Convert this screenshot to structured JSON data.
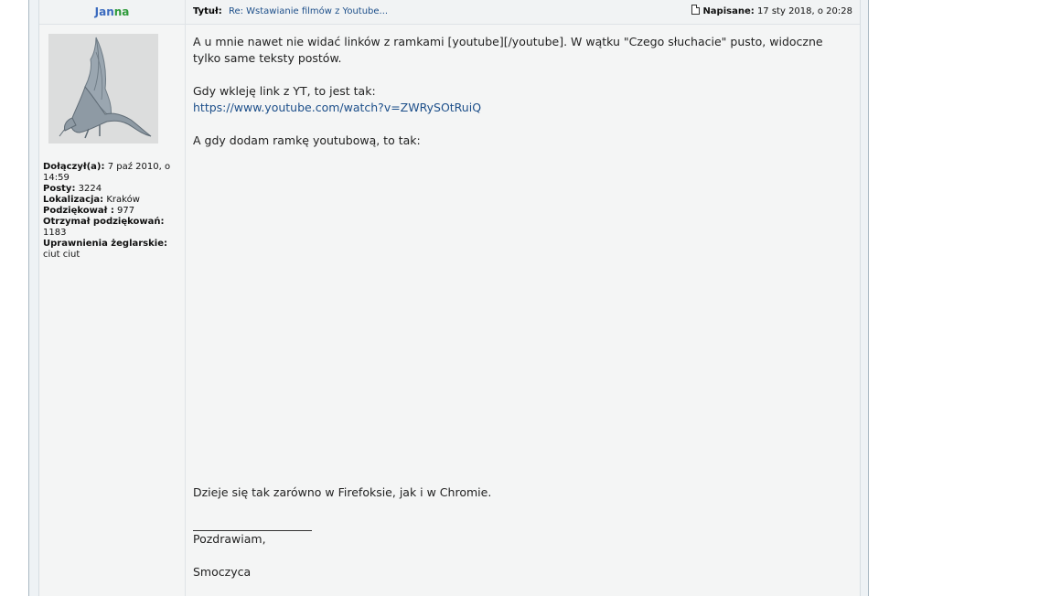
{
  "author": {
    "name_part1": "Jan",
    "name_part2": "na"
  },
  "header": {
    "title_label": "Tytuł:",
    "title_link": "Re: Wstawianie filmów z Youtube...",
    "date_label": "Napisane:",
    "date_value": "17 sty 2018, o 20:28"
  },
  "profile": {
    "joined_label": "Dołączył(a):",
    "joined_value": "7 paź 2010, o 14:59",
    "posts_label": "Posty:",
    "posts_value": "3224",
    "location_label": "Lokalizacja:",
    "location_value": "Kraków",
    "thanked_label": "Podziękował :",
    "thanked_value": "977",
    "received_label": "Otrzymał podziękowań:",
    "received_value": "1183",
    "perms_label": "Uprawnienia żeglarskie:",
    "perms_value": "ciut ciut"
  },
  "message": {
    "para1": "A u mnie nawet nie widać linków z ramkami [youtube][/youtube]. W wątku \"Czego słuchacie\" pusto, widoczne tylko same teksty postów.",
    "para2": "Gdy wkleję link z YT, to jest tak:",
    "link": "https://www.youtube.com/watch?v=ZWRySOtRuiQ",
    "para3": "A gdy dodam ramkę youtubową, to tak:",
    "para4": "Dzieje się tak zarówno w Firefoksie, jak i w Chromie.",
    "greeting": "Pozdrawiam,",
    "signature": "Smoczyca"
  }
}
